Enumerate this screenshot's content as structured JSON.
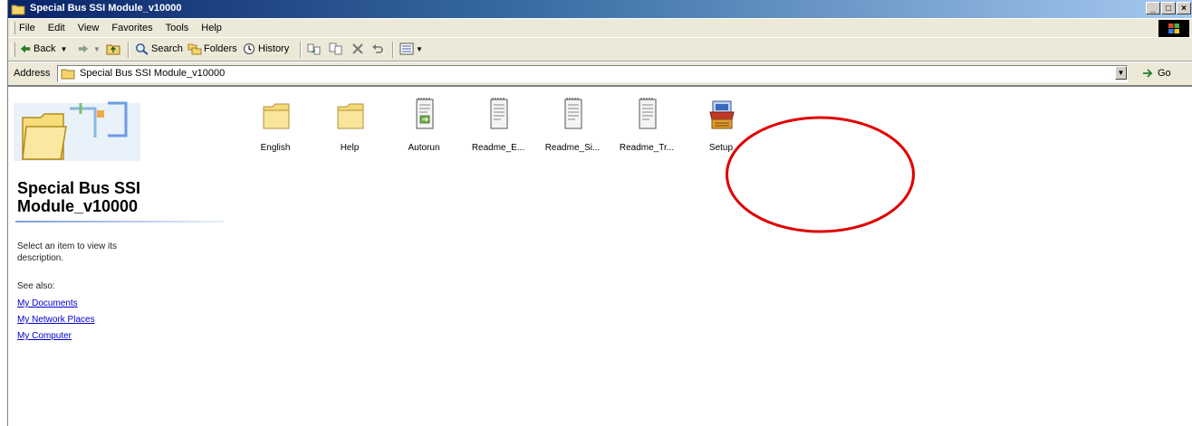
{
  "window": {
    "title": "Special Bus SSI Module_v10000",
    "buttons": {
      "minimize": "_",
      "maximize": "□",
      "close": "×"
    }
  },
  "menu": {
    "items": [
      "File",
      "Edit",
      "View",
      "Favorites",
      "Tools",
      "Help"
    ]
  },
  "toolbar": {
    "back_label": "Back",
    "search_label": "Search",
    "folders_label": "Folders",
    "history_label": "History"
  },
  "address": {
    "label": "Address",
    "value": "Special Bus SSI Module_v10000",
    "go_label": "Go"
  },
  "left_pane": {
    "folder_title": "Special Bus SSI Module_v10000",
    "description": "Select an item to view its description.",
    "see_also_label": "See also:",
    "links": [
      "My Documents",
      "My Network Places",
      "My Computer"
    ]
  },
  "files": [
    {
      "name": "English",
      "icon": "folder-icon"
    },
    {
      "name": "Help",
      "icon": "folder-icon"
    },
    {
      "name": "Autorun",
      "icon": "setup-info-icon"
    },
    {
      "name": "Readme_E...",
      "icon": "text-document-icon"
    },
    {
      "name": "Readme_Si...",
      "icon": "text-document-icon"
    },
    {
      "name": "Readme_Tr...",
      "icon": "text-document-icon"
    },
    {
      "name": "Setup",
      "icon": "setup-installer-icon"
    }
  ],
  "colors": {
    "title_bar_start": "#0a246a",
    "title_bar_end": "#a6caf0",
    "chrome": "#ece9d8",
    "link": "#0000cc",
    "annotation_circle": "#e00000"
  }
}
